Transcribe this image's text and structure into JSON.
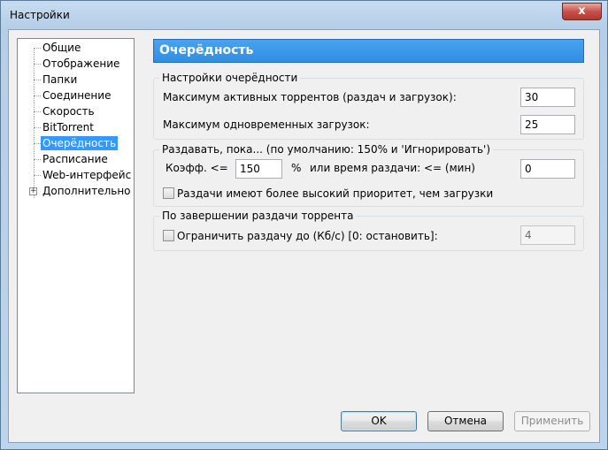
{
  "window": {
    "title": "Настройки",
    "close_glyph": "x"
  },
  "sidebar": {
    "items": [
      {
        "label": "Общие"
      },
      {
        "label": "Отображение"
      },
      {
        "label": "Папки"
      },
      {
        "label": "Соединение"
      },
      {
        "label": "Скорость"
      },
      {
        "label": "BitTorrent"
      },
      {
        "label": "Очерёдность",
        "selected": true
      },
      {
        "label": "Расписание"
      },
      {
        "label": "Web-интерфейс"
      },
      {
        "label": "Дополнительно",
        "expandable": true
      }
    ],
    "expander_glyph": "+"
  },
  "page": {
    "title": "Очерёдность"
  },
  "queue_group": {
    "title": "Настройки очерёдности",
    "max_active_label": "Максимум активных торрентов (раздач и загрузок):",
    "max_active_value": "30",
    "max_downloads_label": "Максимум одновременных загрузок:",
    "max_downloads_value": "25"
  },
  "seed_group": {
    "title": "Раздавать, пока... (по умолчанию: 150% и 'Игнорировать')",
    "ratio_label": "Коэфф. <=",
    "ratio_value": "150",
    "percent_label": "%",
    "time_label": "или время раздачи: <= (мин)",
    "time_value": "0",
    "priority_checkbox_label": "Раздачи имеют более высокий приоритет, чем загрузки",
    "priority_checked": false
  },
  "finish_group": {
    "title": "По завершении раздачи торрента",
    "limit_checkbox_label": "Ограничить раздачу до (Кб/с) [0: остановить]:",
    "limit_checked": false,
    "limit_value": "4"
  },
  "buttons": {
    "ok": "OK",
    "cancel": "Отмена",
    "apply": "Применить"
  }
}
